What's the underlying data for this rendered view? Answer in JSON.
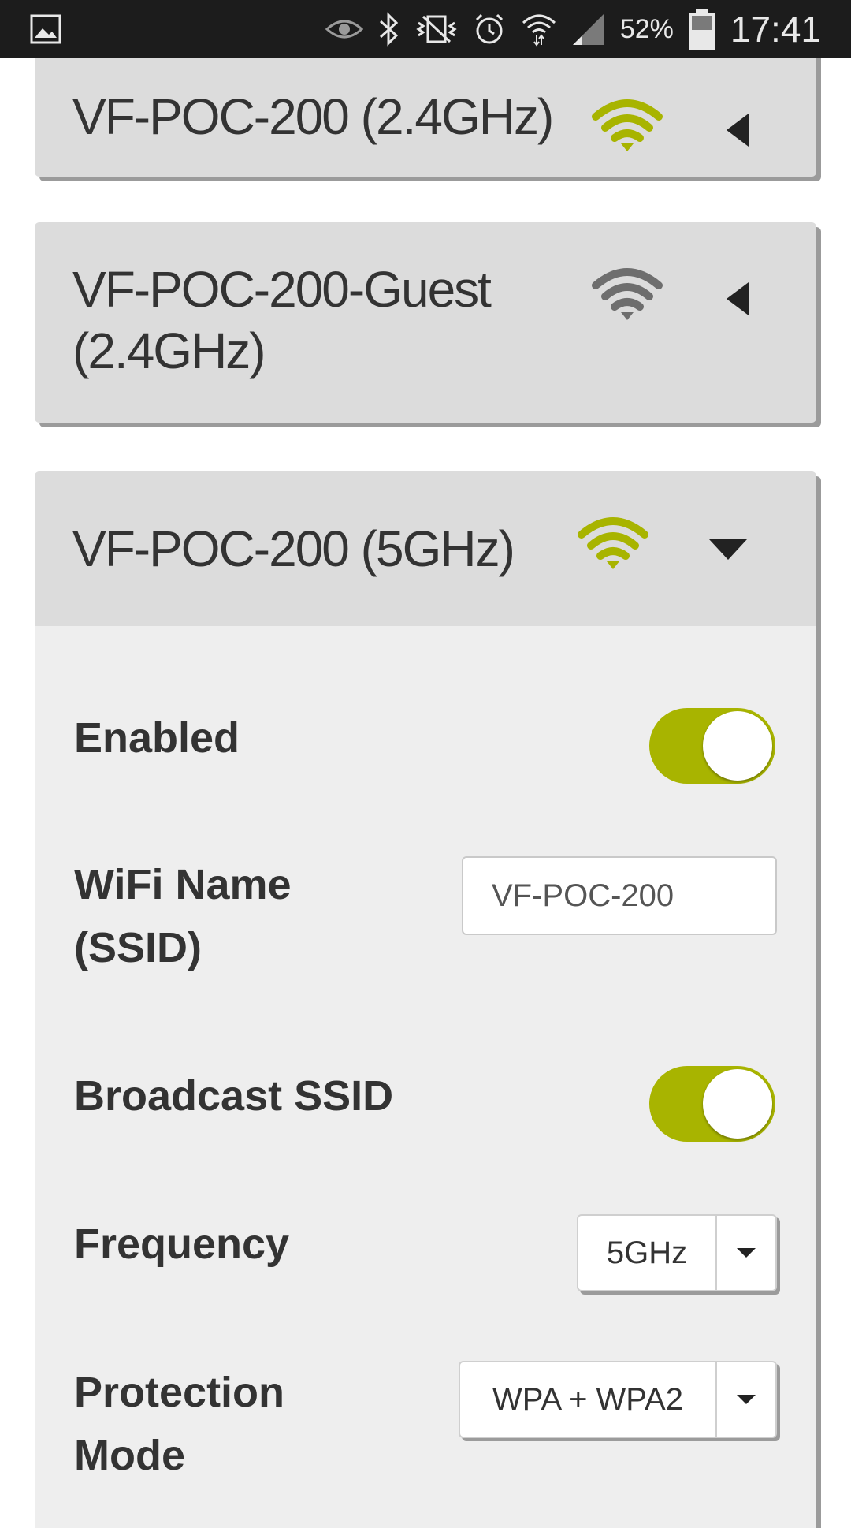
{
  "status_bar": {
    "battery_percent": "52%",
    "time": "17:41",
    "icons": [
      "image-icon",
      "eye-icon",
      "bluetooth-icon",
      "vibrate-icon",
      "alarm-icon",
      "wifi-status-icon",
      "signal-icon",
      "battery-icon"
    ]
  },
  "networks": [
    {
      "title": "VF-POC-200 (2.4GHz)",
      "wifi_color": "#a8b400",
      "expanded": false
    },
    {
      "title": "VF-POC-200-Guest (2.4GHz)",
      "wifi_color": "#6e6e6e",
      "expanded": false
    },
    {
      "title": "VF-POC-200 (5GHz)",
      "wifi_color": "#a8b400",
      "expanded": true
    }
  ],
  "settings": {
    "enabled_label": "Enabled",
    "enabled_value": true,
    "ssid_label": "WiFi Name (SSID)",
    "ssid_value": "VF-POC-200",
    "broadcast_label": "Broadcast SSID",
    "broadcast_value": true,
    "frequency_label": "Frequency",
    "frequency_value": "5GHz",
    "protection_label": "Protection Mode",
    "protection_value": "WPA + WPA2"
  },
  "colors": {
    "accent": "#a8b400",
    "card": "#dcdcdc",
    "panel": "#eeeeee",
    "text": "#333333"
  }
}
